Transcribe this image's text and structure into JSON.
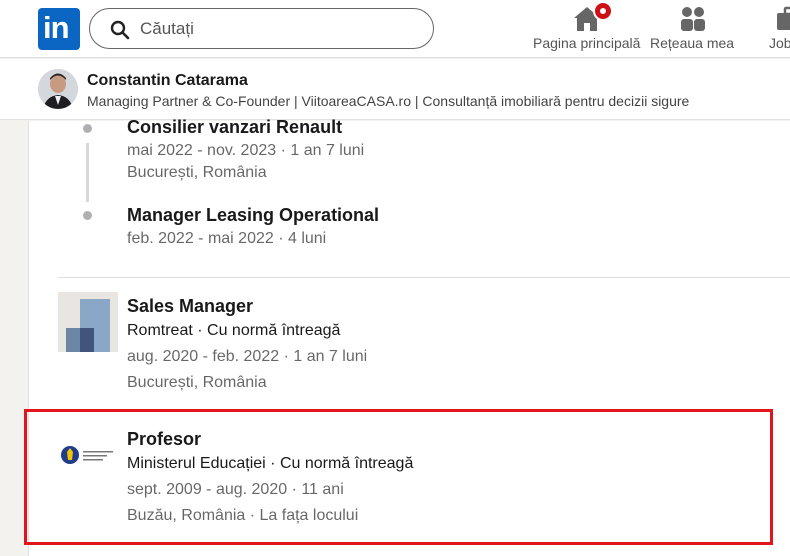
{
  "nav": {
    "logo_text": "in",
    "search_placeholder": "Căutați",
    "items": [
      {
        "label": "Pagina principală",
        "icon": "home-icon"
      },
      {
        "label": "Rețeaua mea",
        "icon": "my-network-icon"
      },
      {
        "label": "Job",
        "icon": "jobs-icon"
      }
    ]
  },
  "profile": {
    "name": "Constantin Catarama",
    "headline": "Managing Partner & Co-Founder | ViitoareaCASA.ro | Consultanță imobiliară pentru decizii sigure"
  },
  "experience": {
    "grouped_roles": [
      {
        "title": "Consilier vanzari Renault",
        "dates": "mai 2022 - nov. 2023 · 1 an 7 luni",
        "location": "București, România"
      },
      {
        "title": "Manager Leasing Operational",
        "dates": "feb. 2022 - mai 2022 · 4 luni"
      }
    ],
    "entries": [
      {
        "title": "Sales Manager",
        "company": "Romtreat · Cu normă întreagă",
        "dates": "aug. 2020 - feb. 2022 · 1 an 7 luni",
        "location": "București, România",
        "logo_icon": "romtreat-logo-icon"
      },
      {
        "title": "Profesor",
        "company": "Ministerul Educației · Cu normă întreagă",
        "dates": "sept. 2009 - aug. 2020 · 11 ani",
        "location": "Buzău, România · La fața locului",
        "logo_icon": "ministry-education-logo-icon"
      }
    ]
  },
  "colors": {
    "brand": "#0a66c2",
    "highlight": "#e0161c",
    "notification": "#cc1016"
  }
}
